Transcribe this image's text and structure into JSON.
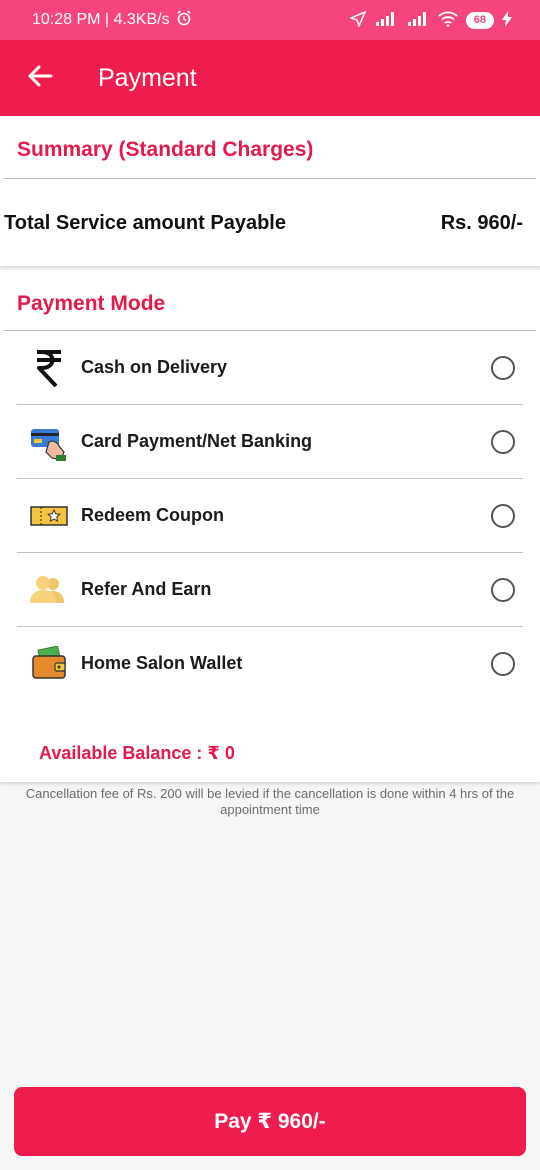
{
  "status_bar": {
    "time_speed": "10:28 PM | 4.3KB/s",
    "battery": "68"
  },
  "app_bar": {
    "title": "Payment",
    "back_icon": "arrow-left-icon"
  },
  "summary": {
    "title": "Summary (Standard Charges)",
    "total_label": "Total Service amount Payable",
    "total_amount": "Rs. 960/-"
  },
  "payment_mode": {
    "title": "Payment Mode",
    "options": [
      {
        "label": "Cash on Delivery",
        "icon": "rupee-icon",
        "selected": false
      },
      {
        "label": "Card Payment/Net Banking",
        "icon": "card-payment-icon",
        "selected": false
      },
      {
        "label": "Redeem Coupon",
        "icon": "coupon-icon",
        "selected": false
      },
      {
        "label": "Refer And Earn",
        "icon": "users-icon",
        "selected": false
      },
      {
        "label": "Home Salon Wallet",
        "icon": "wallet-icon",
        "selected": false
      }
    ],
    "available_balance": "Available Balance : ₹ 0"
  },
  "notice": "Cancellation fee of Rs. 200 will be levied if the cancellation is done within 4 hrs of the appointment time",
  "pay_button": "Pay ₹ 960/-",
  "colors": {
    "primary": "#ef1d4e",
    "status_bar": "#f5457a",
    "accent_text": "#e31b4b"
  }
}
